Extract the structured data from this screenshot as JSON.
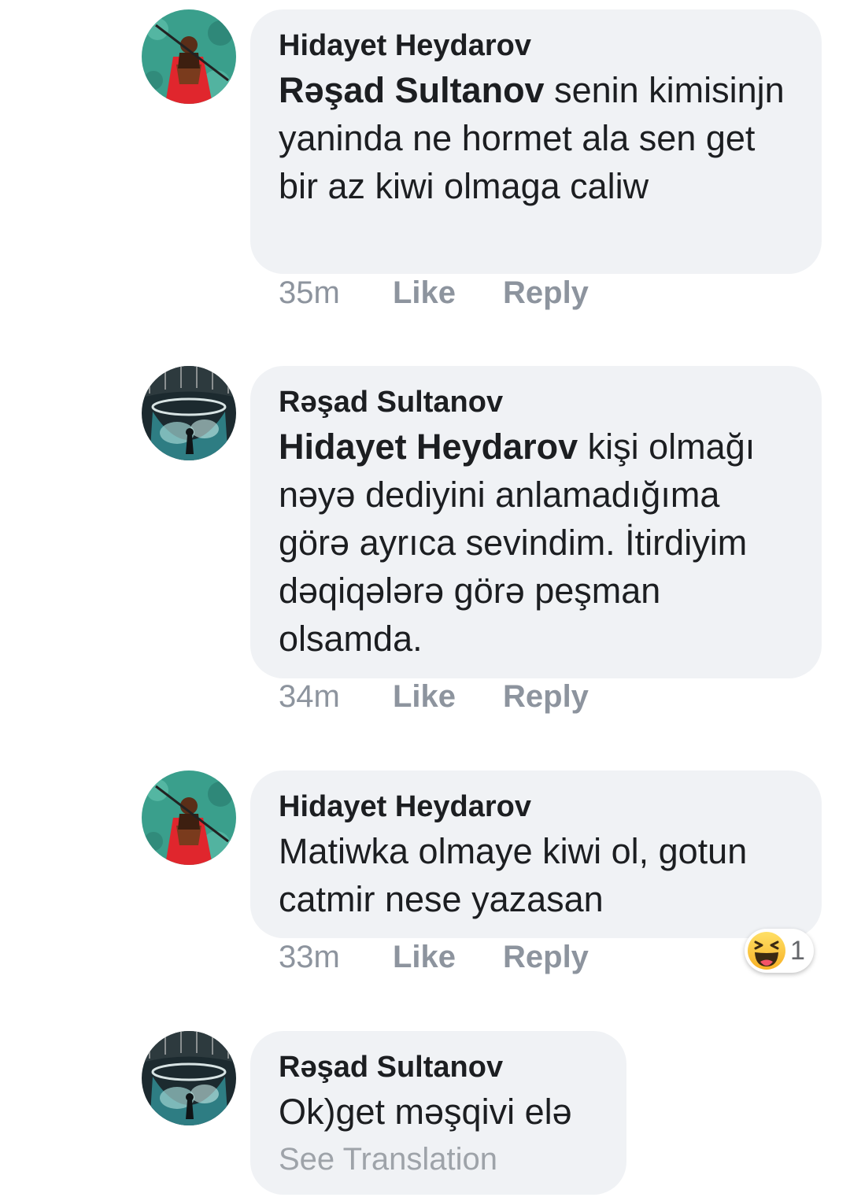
{
  "comments": [
    {
      "author": "Hidayet Heydarov",
      "avatar_icon": "avatar-kayak-icon",
      "mention": "Rəşad Sultanov",
      "text": " senin kimisinjn yaninda ne hormet ala sen get bir az kiwi olmaga caliw",
      "time": "35m",
      "like": "Like",
      "reply": "Reply"
    },
    {
      "author": "Rəşad Sultanov",
      "avatar_icon": "avatar-underwater-icon",
      "mention": "Hidayet Heydarov",
      "text": " kişi olmağı nəyə dediyini anlamadığıma görə ayrıca sevindim. İtirdiyim dəqiqələrə görə peşman olsamda.",
      "time": "34m",
      "like": "Like",
      "reply": "Reply"
    },
    {
      "author": "Hidayet Heydarov",
      "avatar_icon": "avatar-kayak-icon",
      "text": "Matiwka olmaye kiwi ol, gotun catmir nese yazasan",
      "time": "33m",
      "like": "Like",
      "reply": "Reply",
      "reaction": {
        "icon": "haha-emoji-icon",
        "count": "1"
      }
    },
    {
      "author": "Rəşad Sultanov",
      "avatar_icon": "avatar-underwater-icon",
      "text": "Ok)get məşqivi elə",
      "see_translation": "See Translation"
    }
  ],
  "colors": {
    "bubble_bg": "#f0f2f5",
    "text": "#1c1e21",
    "action": "#8d949e",
    "see_translation": "#9ea3a9"
  }
}
